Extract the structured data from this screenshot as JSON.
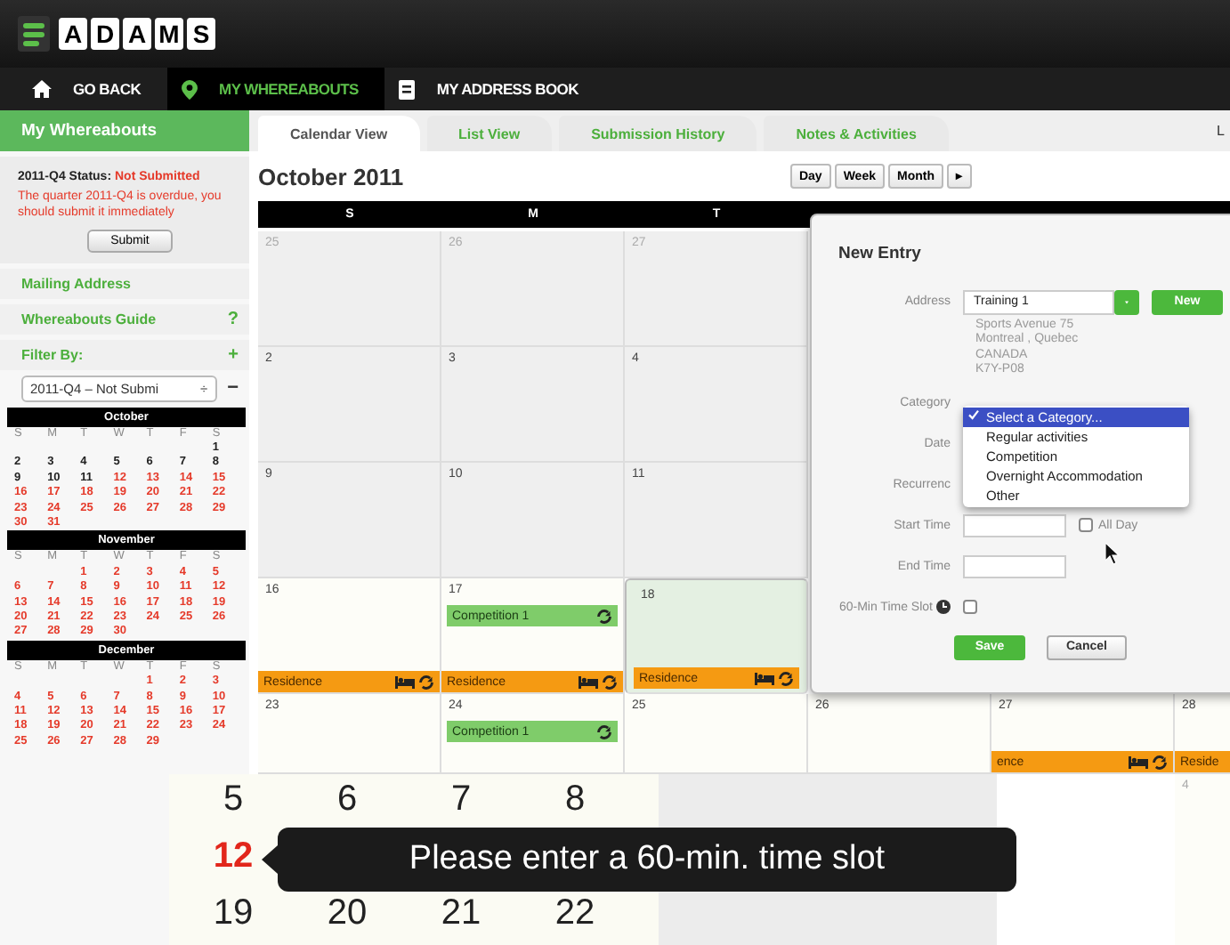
{
  "logo": {
    "letters": [
      "A",
      "D",
      "A",
      "M",
      "S"
    ]
  },
  "nav": [
    {
      "label": "GO BACK",
      "selected": false
    },
    {
      "label": "MY WHEREABOUTS",
      "selected": true
    },
    {
      "label": "MY ADDRESS BOOK",
      "selected": false
    }
  ],
  "tabs": [
    {
      "label": "Calendar View",
      "selected": true
    },
    {
      "label": "List View",
      "selected": false
    },
    {
      "label": "Submission History",
      "selected": false
    },
    {
      "label": "Notes & Activities",
      "selected": false
    }
  ],
  "tabs_overflow": "L",
  "sidebar": {
    "title": "My Whereabouts",
    "status_label": "2011-Q4 Status:",
    "status_value": "Not Submitted",
    "warning": "The quarter 2011-Q4 is overdue, you should submit it immediately",
    "submit": "Submit",
    "links": [
      {
        "label": "Mailing Address",
        "kind": "link"
      },
      {
        "label": "Whereabouts Guide",
        "kind": "help",
        "action": "?"
      },
      {
        "label": "Filter By:",
        "kind": "expand",
        "action": "+"
      }
    ],
    "filter": {
      "value": "2011-Q4 – Not Submi",
      "arrows": "÷",
      "remove": "−"
    },
    "months": [
      {
        "name": "October",
        "weekdays": [
          "S",
          "M",
          "T",
          "W",
          "T",
          "F",
          "S"
        ],
        "weeks": [
          [
            {
              "kind": "blank"
            },
            {
              "kind": "blank"
            },
            {
              "kind": "blank"
            },
            {
              "kind": "blank"
            },
            {
              "kind": "blank"
            },
            {
              "kind": "blank"
            },
            {
              "kind": "day",
              "n": "1",
              "overdue": false
            }
          ],
          [
            {
              "kind": "day",
              "n": "2",
              "overdue": false
            },
            {
              "kind": "day",
              "n": "3",
              "overdue": false
            },
            {
              "kind": "day",
              "n": "4",
              "overdue": false
            },
            {
              "kind": "day",
              "n": "5",
              "overdue": false
            },
            {
              "kind": "day",
              "n": "6",
              "overdue": false
            },
            {
              "kind": "day",
              "n": "7",
              "overdue": false
            },
            {
              "kind": "day",
              "n": "8",
              "overdue": false
            }
          ],
          [
            {
              "kind": "day",
              "n": "9",
              "overdue": false
            },
            {
              "kind": "day",
              "n": "10",
              "overdue": false
            },
            {
              "kind": "day",
              "n": "11",
              "overdue": false
            },
            {
              "kind": "day",
              "n": "12",
              "overdue": true
            },
            {
              "kind": "day",
              "n": "13",
              "overdue": true
            },
            {
              "kind": "day",
              "n": "14",
              "overdue": true
            },
            {
              "kind": "day",
              "n": "15",
              "overdue": true
            }
          ],
          [
            {
              "kind": "day",
              "n": "16",
              "overdue": true
            },
            {
              "kind": "day",
              "n": "17",
              "overdue": true
            },
            {
              "kind": "day",
              "n": "18",
              "overdue": true
            },
            {
              "kind": "day",
              "n": "19",
              "overdue": true
            },
            {
              "kind": "day",
              "n": "20",
              "overdue": true
            },
            {
              "kind": "day",
              "n": "21",
              "overdue": true
            },
            {
              "kind": "day",
              "n": "22",
              "overdue": true
            }
          ],
          [
            {
              "kind": "day",
              "n": "23",
              "overdue": true
            },
            {
              "kind": "day",
              "n": "24",
              "overdue": true
            },
            {
              "kind": "day",
              "n": "25",
              "overdue": true
            },
            {
              "kind": "day",
              "n": "26",
              "overdue": true
            },
            {
              "kind": "day",
              "n": "27",
              "overdue": true
            },
            {
              "kind": "day",
              "n": "28",
              "overdue": true
            },
            {
              "kind": "day",
              "n": "29",
              "overdue": true
            }
          ],
          [
            {
              "kind": "day",
              "n": "30",
              "overdue": true
            },
            {
              "kind": "day",
              "n": "31",
              "overdue": true
            }
          ]
        ]
      },
      {
        "name": "November",
        "weekdays": [
          "S",
          "M",
          "T",
          "W",
          "T",
          "F",
          "S"
        ],
        "weeks": [
          [
            {
              "kind": "blank"
            },
            {
              "kind": "blank"
            },
            {
              "kind": "day",
              "n": "1",
              "overdue": true
            },
            {
              "kind": "day",
              "n": "2",
              "overdue": true
            },
            {
              "kind": "day",
              "n": "3",
              "overdue": true
            },
            {
              "kind": "day",
              "n": "4",
              "overdue": true
            },
            {
              "kind": "day",
              "n": "5",
              "overdue": true
            }
          ],
          [
            {
              "kind": "day",
              "n": "6",
              "overdue": true
            },
            {
              "kind": "day",
              "n": "7",
              "overdue": true
            },
            {
              "kind": "day",
              "n": "8",
              "overdue": true
            },
            {
              "kind": "day",
              "n": "9",
              "overdue": true
            },
            {
              "kind": "day",
              "n": "10",
              "overdue": true
            },
            {
              "kind": "day",
              "n": "11",
              "overdue": true
            },
            {
              "kind": "day",
              "n": "12",
              "overdue": true
            }
          ],
          [
            {
              "kind": "day",
              "n": "13",
              "overdue": true
            },
            {
              "kind": "day",
              "n": "14",
              "overdue": true
            },
            {
              "kind": "day",
              "n": "15",
              "overdue": true
            },
            {
              "kind": "day",
              "n": "16",
              "overdue": true
            },
            {
              "kind": "day",
              "n": "17",
              "overdue": true
            },
            {
              "kind": "day",
              "n": "18",
              "overdue": true
            },
            {
              "kind": "day",
              "n": "19",
              "overdue": true
            }
          ],
          [
            {
              "kind": "day",
              "n": "20",
              "overdue": true
            },
            {
              "kind": "day",
              "n": "21",
              "overdue": true
            },
            {
              "kind": "day",
              "n": "22",
              "overdue": true
            },
            {
              "kind": "day",
              "n": "23",
              "overdue": true
            },
            {
              "kind": "day",
              "n": "24",
              "overdue": true
            },
            {
              "kind": "day",
              "n": "25",
              "overdue": true
            },
            {
              "kind": "day",
              "n": "26",
              "overdue": true
            }
          ],
          [
            {
              "kind": "day",
              "n": "27",
              "overdue": true
            },
            {
              "kind": "day",
              "n": "28",
              "overdue": true
            },
            {
              "kind": "day",
              "n": "29",
              "overdue": true
            },
            {
              "kind": "day",
              "n": "30",
              "overdue": true
            }
          ]
        ]
      },
      {
        "name": "December",
        "weekdays": [
          "S",
          "M",
          "T",
          "W",
          "T",
          "F",
          "S"
        ],
        "weeks": [
          [
            {
              "kind": "blank"
            },
            {
              "kind": "blank"
            },
            {
              "kind": "blank"
            },
            {
              "kind": "blank"
            },
            {
              "kind": "day",
              "n": "1",
              "overdue": true
            },
            {
              "kind": "day",
              "n": "2",
              "overdue": true
            },
            {
              "kind": "day",
              "n": "3",
              "overdue": true
            }
          ],
          [
            {
              "kind": "day",
              "n": "4",
              "overdue": true
            },
            {
              "kind": "day",
              "n": "5",
              "overdue": true
            },
            {
              "kind": "day",
              "n": "6",
              "overdue": true
            },
            {
              "kind": "day",
              "n": "7",
              "overdue": true
            },
            {
              "kind": "day",
              "n": "8",
              "overdue": true
            },
            {
              "kind": "day",
              "n": "9",
              "overdue": true
            },
            {
              "kind": "day",
              "n": "10",
              "overdue": true
            }
          ],
          [
            {
              "kind": "day",
              "n": "11",
              "overdue": true
            },
            {
              "kind": "day",
              "n": "12",
              "overdue": true
            },
            {
              "kind": "day",
              "n": "13",
              "overdue": true
            },
            {
              "kind": "day",
              "n": "14",
              "overdue": true
            },
            {
              "kind": "day",
              "n": "15",
              "overdue": true
            },
            {
              "kind": "day",
              "n": "16",
              "overdue": true
            },
            {
              "kind": "day",
              "n": "17",
              "overdue": true
            }
          ],
          [
            {
              "kind": "day",
              "n": "18",
              "overdue": true
            },
            {
              "kind": "day",
              "n": "19",
              "overdue": true
            },
            {
              "kind": "day",
              "n": "20",
              "overdue": true
            },
            {
              "kind": "day",
              "n": "21",
              "overdue": true
            },
            {
              "kind": "day",
              "n": "22",
              "overdue": true
            },
            {
              "kind": "day",
              "n": "23",
              "overdue": true
            },
            {
              "kind": "day",
              "n": "24",
              "overdue": true
            }
          ],
          [
            {
              "kind": "day",
              "n": "25",
              "overdue": true
            },
            {
              "kind": "day",
              "n": "26",
              "overdue": true
            },
            {
              "kind": "day",
              "n": "27",
              "overdue": true
            },
            {
              "kind": "day",
              "n": "28",
              "overdue": true
            },
            {
              "kind": "day",
              "n": "29",
              "overdue": true
            }
          ]
        ]
      }
    ]
  },
  "calendar": {
    "title": "October 2011",
    "views": [
      "Day",
      "Week",
      "Month",
      "▸"
    ],
    "weekdays": [
      "S",
      "M",
      "T"
    ],
    "weeks": [
      [
        {
          "kind": "day",
          "day": "25",
          "other_month": true,
          "past": true,
          "selected": false
        },
        {
          "kind": "day",
          "day": "26",
          "other_month": true,
          "past": true,
          "selected": false
        },
        {
          "kind": "day",
          "day": "27",
          "other_month": true,
          "past": true,
          "selected": false
        },
        {
          "kind": "blank"
        },
        {
          "kind": "blank"
        },
        {
          "kind": "blank"
        }
      ],
      [
        {
          "kind": "day",
          "day": "2",
          "other_month": false,
          "past": true,
          "selected": false
        },
        {
          "kind": "day",
          "day": "3",
          "other_month": false,
          "past": true,
          "selected": false
        },
        {
          "kind": "day",
          "day": "4",
          "other_month": false,
          "past": true,
          "selected": false
        },
        {
          "kind": "blank"
        },
        {
          "kind": "blank"
        },
        {
          "kind": "blank"
        }
      ],
      [
        {
          "kind": "day",
          "day": "9",
          "other_month": false,
          "past": true,
          "selected": false
        },
        {
          "kind": "day",
          "day": "10",
          "other_month": false,
          "past": true,
          "selected": false
        },
        {
          "kind": "day",
          "day": "11",
          "other_month": false,
          "past": true,
          "selected": false
        },
        {
          "kind": "blank"
        },
        {
          "kind": "blank"
        },
        {
          "kind": "blank"
        }
      ],
      [
        {
          "kind": "day",
          "day": "16",
          "other_month": false,
          "past": false,
          "selected": false,
          "events": [
            {
              "kind": "residence",
              "label": "Residence"
            }
          ]
        },
        {
          "kind": "day",
          "day": "17",
          "other_month": false,
          "past": false,
          "selected": false,
          "events": [
            {
              "kind": "competition",
              "label": "Competition 1"
            },
            {
              "kind": "residence",
              "label": "Residence"
            }
          ]
        },
        {
          "kind": "day",
          "day": "18",
          "other_month": false,
          "past": false,
          "selected": true,
          "events": [
            {
              "kind": "residence",
              "label": "Residence"
            }
          ]
        },
        {
          "kind": "blank"
        },
        {
          "kind": "blank"
        },
        {
          "kind": "blank"
        }
      ],
      [
        {
          "kind": "day",
          "day": "23",
          "other_month": false,
          "past": false,
          "selected": false
        },
        {
          "kind": "day",
          "day": "24",
          "other_month": false,
          "past": false,
          "selected": false,
          "events": [
            {
              "kind": "competition",
              "label": "Competition 1"
            }
          ]
        },
        {
          "kind": "day",
          "day": "25",
          "other_month": false,
          "past": false,
          "selected": false
        },
        {
          "kind": "day",
          "day": "26",
          "other_month": false,
          "past": false,
          "selected": false
        },
        {
          "kind": "day",
          "day": "27",
          "other_month": false,
          "past": false,
          "selected": false,
          "events": [
            {
              "kind": "residence",
              "label": "ence"
            }
          ]
        },
        {
          "kind": "day",
          "day": "28",
          "other_month": false,
          "past": false,
          "selected": false,
          "events": [
            {
              "kind": "residence",
              "label": "Reside",
              "cut_off": true
            }
          ]
        }
      ],
      [
        {
          "kind": "blank"
        },
        {
          "kind": "blank"
        },
        {
          "kind": "blank"
        },
        {
          "kind": "blank"
        },
        {
          "kind": "blank"
        },
        {
          "kind": "day",
          "day": "4",
          "other_month": true,
          "past": false,
          "selected": false
        }
      ]
    ]
  },
  "dialog": {
    "title": "New Entry",
    "address_label": "Address",
    "address_value": "Training 1",
    "new_button": "New",
    "address_lines": [
      "Sports Avenue 75",
      "Montreal , Quebec",
      "CANADA",
      "K7Y-P08"
    ],
    "category_label": "Category",
    "date_label": "Date",
    "recurrence_label": "Recurrenc",
    "category_options": [
      {
        "label": "Select a Category...",
        "selected": true
      },
      {
        "label": "Regular activities",
        "selected": false
      },
      {
        "label": "Competition",
        "selected": false
      },
      {
        "label": "Overnight Accommodation",
        "selected": false
      },
      {
        "label": "Other",
        "selected": false
      }
    ],
    "start_label": "Start Time",
    "all_day": {
      "label": "All Day",
      "checked": false
    },
    "end_label": "End Time",
    "slot": {
      "label": "60-Min Time Slot",
      "checked": false
    },
    "save": "Save",
    "cancel": "Cancel"
  },
  "callout": {
    "dates": [
      [
        {
          "n": "5",
          "overdue": false
        },
        {
          "n": "6",
          "overdue": false
        },
        {
          "n": "7",
          "overdue": false
        },
        {
          "n": "8",
          "overdue": false
        }
      ],
      [
        {
          "n": "12",
          "overdue": true
        }
      ],
      [
        {
          "n": "19",
          "overdue": false
        },
        {
          "n": "20",
          "overdue": false
        },
        {
          "n": "21",
          "overdue": false
        },
        {
          "n": "22",
          "overdue": false
        }
      ]
    ],
    "tooltip": "Please enter a 60-min. time slot"
  }
}
